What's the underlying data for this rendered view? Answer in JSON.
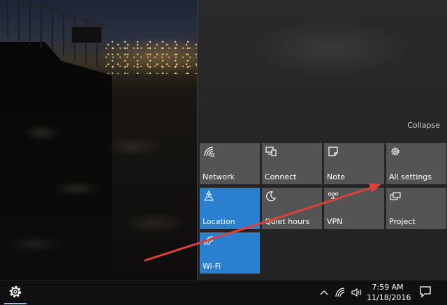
{
  "action_center": {
    "collapse_label": "Collapse",
    "tiles": [
      {
        "label": "Network",
        "icon": "network-icon",
        "active": false
      },
      {
        "label": "Connect",
        "icon": "connect-icon",
        "active": false
      },
      {
        "label": "Note",
        "icon": "note-icon",
        "active": false
      },
      {
        "label": "All settings",
        "icon": "gear-icon",
        "active": false
      },
      {
        "label": "Location",
        "icon": "location-icon",
        "active": true
      },
      {
        "label": "Quiet hours",
        "icon": "moon-icon",
        "active": false
      },
      {
        "label": "VPN",
        "icon": "vpn-icon",
        "active": false
      },
      {
        "label": "Project",
        "icon": "project-icon",
        "active": false
      },
      {
        "label": "Wi-Fi",
        "icon": "wifi-icon",
        "active": true
      }
    ]
  },
  "taskbar": {
    "start_icon": "gear-icon",
    "clock": {
      "time": "7:59 AM",
      "date": "11/18/2016"
    },
    "tray_icons": [
      "chevron-up-icon",
      "wifi-icon",
      "volume-icon"
    ],
    "notification_icon": "action-center-icon"
  },
  "annotation": {
    "color": "#e0403a"
  },
  "colors": {
    "tile": "#545454",
    "tile_active": "#2b7fd0",
    "panel": "#262627",
    "taskbar": "#101012"
  }
}
